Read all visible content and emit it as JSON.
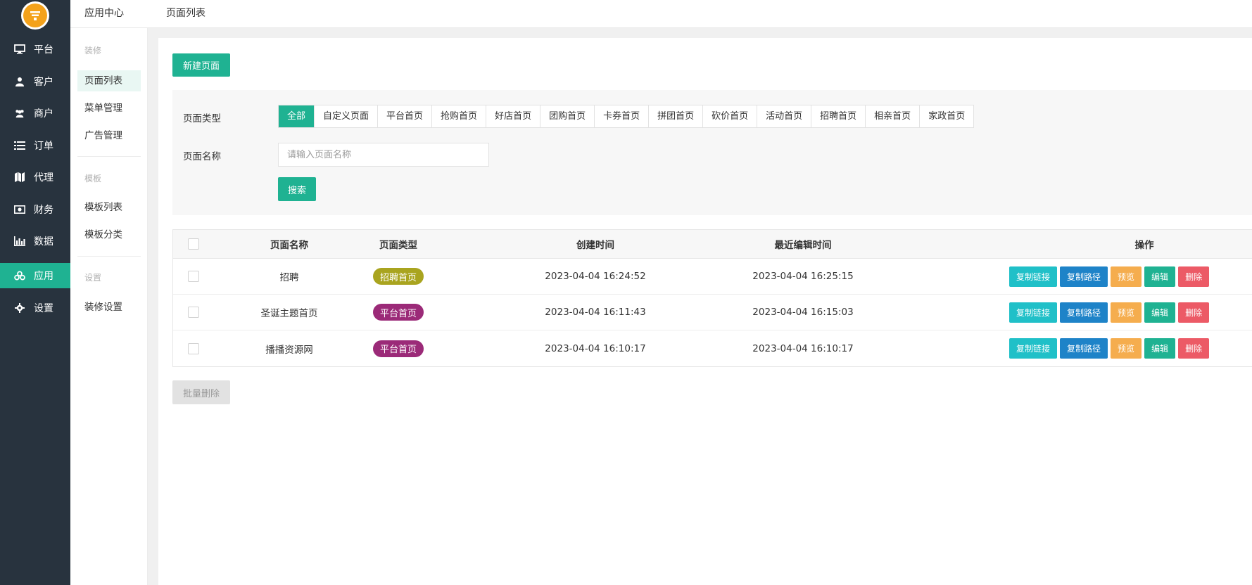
{
  "nav": {
    "items": [
      {
        "label": "平台",
        "icon": "monitor-icon"
      },
      {
        "label": "客户",
        "icon": "user-icon"
      },
      {
        "label": "商户",
        "icon": "users-icon"
      },
      {
        "label": "订单",
        "icon": "list-icon"
      },
      {
        "label": "代理",
        "icon": "map-icon"
      },
      {
        "label": "财务",
        "icon": "money-icon"
      },
      {
        "label": "数据",
        "icon": "bar-chart-icon"
      },
      {
        "label": "应用",
        "icon": "cubes-icon"
      },
      {
        "label": "设置",
        "icon": "gear-icon"
      }
    ],
    "active_index": 7,
    "accent": "#1fb292"
  },
  "breadcrumb": {
    "first": "应用中心",
    "second": "页面列表"
  },
  "submenu": {
    "groups": [
      {
        "title": "装修",
        "items": [
          "页面列表",
          "菜单管理",
          "广告管理"
        ]
      },
      {
        "title": "模板",
        "items": [
          "模板列表",
          "模板分类"
        ]
      },
      {
        "title": "设置",
        "items": [
          "装修设置"
        ]
      }
    ],
    "active": "页面列表"
  },
  "toolbar": {
    "new_page_label": "新建页面"
  },
  "filter": {
    "type_label": "页面类型",
    "name_label": "页面名称",
    "tabs": [
      "全部",
      "自定义页面",
      "平台首页",
      "抢购首页",
      "好店首页",
      "团购首页",
      "卡券首页",
      "拼团首页",
      "砍价首页",
      "活动首页",
      "招聘首页",
      "相亲首页",
      "家政首页"
    ],
    "active_tab": 0,
    "name_placeholder": "请输入页面名称",
    "name_value": "",
    "search_label": "搜索"
  },
  "table": {
    "columns": [
      "页面名称",
      "页面类型",
      "创建时间",
      "最近编辑时间",
      "操作"
    ],
    "rows": [
      {
        "name": "招聘",
        "type": "招聘首页",
        "type_color": "#a9a41f",
        "created": "2023-04-04 16:24:52",
        "edited": "2023-04-04 16:25:15"
      },
      {
        "name": "圣诞主题首页",
        "type": "平台首页",
        "type_color": "#9b2a78",
        "created": "2023-04-04 16:11:43",
        "edited": "2023-04-04 16:15:03"
      },
      {
        "name": "播播资源网",
        "type": "平台首页",
        "type_color": "#9b2a78",
        "created": "2023-04-04 16:10:17",
        "edited": "2023-04-04 16:10:17"
      }
    ],
    "actions": [
      {
        "label": "复制链接",
        "color": "#20c0c8"
      },
      {
        "label": "复制路径",
        "color": "#1e83c8"
      },
      {
        "label": "预览",
        "color": "#f5ad4e"
      },
      {
        "label": "编辑",
        "color": "#1fb292"
      },
      {
        "label": "删除",
        "color": "#ec5a66"
      }
    ]
  },
  "footer": {
    "batch_delete_label": "批量删除"
  }
}
